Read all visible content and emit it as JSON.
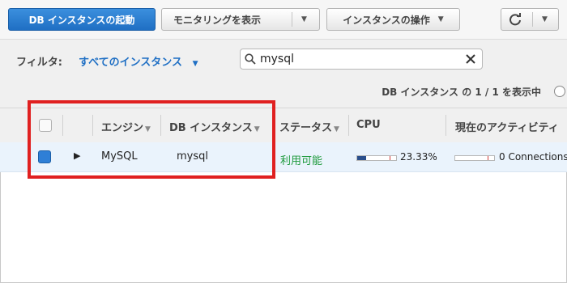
{
  "toolbar": {
    "launch_db": "DB インスタンスの起動",
    "show_monitoring": "モニタリングを表示",
    "instance_actions": "インスタンスの操作"
  },
  "filter": {
    "label": "フィルタ:",
    "selected": "すべてのインスタンス",
    "search_value": "mysql",
    "count_text": "DB インスタンス の 1 / 1 を表示中"
  },
  "table": {
    "columns": {
      "engine": "エンジン",
      "db_instance": "DB インスタンス",
      "status": "ステータス",
      "cpu": "CPU",
      "activity": "現在のアクティビティ"
    },
    "rows": [
      {
        "engine": "MySQL",
        "db_instance": "mysql",
        "status": "利用可能",
        "cpu_percent": "23.33%",
        "cpu_fill_fraction": 0.2333,
        "connections": "0 Connections",
        "connections_fill_fraction": 0.0
      }
    ]
  },
  "icons": {
    "refresh": "refresh-icon",
    "search": "search-icon",
    "clear": "close-icon",
    "expand": "triangle-right-icon"
  },
  "colors": {
    "primary": "#1f6fc4",
    "status_available": "#1e9a3c",
    "highlight": "#e02020",
    "cpu_bar": "#2a4f8c"
  }
}
